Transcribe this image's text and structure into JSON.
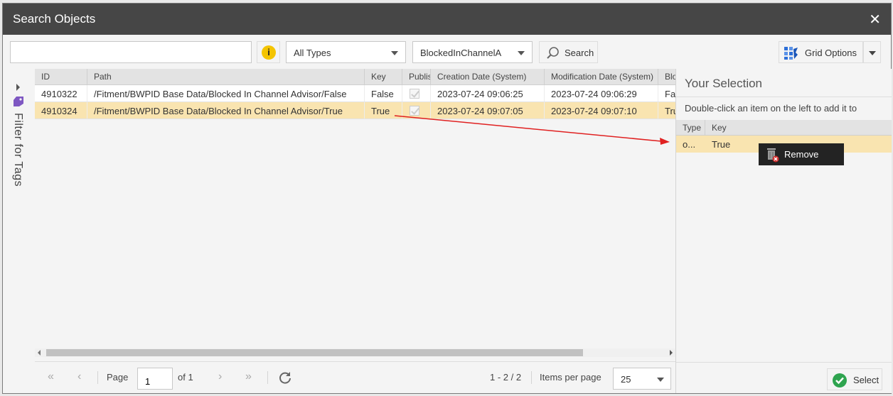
{
  "window": {
    "title": "Search Objects",
    "close_glyph": "✕"
  },
  "toolbar": {
    "search_value": "",
    "info_glyph": "i",
    "type_filter": "All Types",
    "class_filter": "BlockedInChannelA",
    "search_label": "Search",
    "grid_options_label": "Grid Options"
  },
  "tag_panel": {
    "label": "Filter for Tags"
  },
  "grid": {
    "columns": [
      "ID",
      "Path",
      "Key",
      "Publis",
      "Creation Date (System)",
      "Modification Date (System)",
      "Blo"
    ],
    "rows": [
      {
        "id": "4910322",
        "path": "/Fitment/BWPID Base Data/Blocked In Channel Advisor/False",
        "key": "False",
        "published": true,
        "created": "2023-07-24 09:06:25",
        "modified": "2023-07-24 09:06:29",
        "extra": "Fa"
      },
      {
        "id": "4910324",
        "path": "/Fitment/BWPID Base Data/Blocked In Channel Advisor/True",
        "key": "True",
        "published": true,
        "created": "2023-07-24 09:07:05",
        "modified": "2023-07-24 09:07:10",
        "extra": "Tru"
      }
    ],
    "selected_row": 1
  },
  "pager": {
    "page_label": "Page",
    "page_value": "1",
    "of_label": "of 1",
    "range_label": "1 - 2 / 2",
    "items_per_page_label": "Items per page",
    "items_per_page_value": "25"
  },
  "selection": {
    "title": "Your Selection",
    "hint": "Double-click an item on the left to add it to",
    "columns": [
      "Type",
      "Key"
    ],
    "rows": [
      {
        "type": "o...",
        "key": "True"
      }
    ],
    "select_label": "Select"
  },
  "context_menu": {
    "remove_label": "Remove"
  },
  "colors": {
    "titlebar": "#464646",
    "selected_row": "#f9e4b0",
    "info": "#f4c400",
    "select_ok": "#2ea44f",
    "arrow": "#e02020"
  }
}
